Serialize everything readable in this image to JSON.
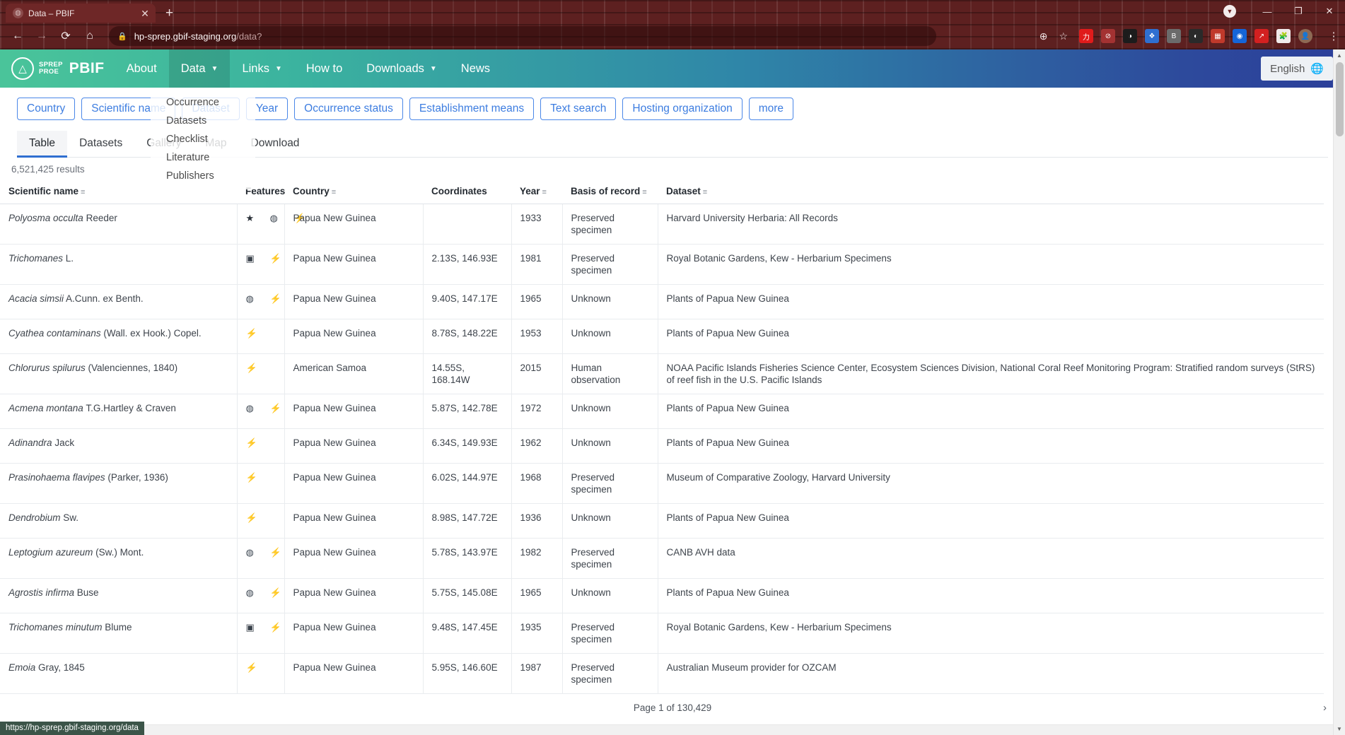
{
  "browser": {
    "tab": {
      "title": "Data – PBIF",
      "favicon_icon": "globe-icon",
      "close_icon": "✕"
    },
    "newtab_icon": "+",
    "window_controls": {
      "download_icon": "▼",
      "minimize": "—",
      "maximize": "❐",
      "close": "✕"
    },
    "nav": {
      "back": "←",
      "forward": "→",
      "reload": "⟳",
      "home": "⌂"
    },
    "omnibox": {
      "lock_icon": "🔒",
      "url_host": "hp-sprep.gbif-staging.org",
      "url_path": "/data?",
      "zoom_icon": "⊕",
      "bookmark_icon": "☆"
    },
    "extensions": [
      {
        "name": "extension-red-circle",
        "glyph": "力",
        "color": "#e01b1b"
      },
      {
        "name": "extension-adblock",
        "glyph": "⊘",
        "color": "#a33232"
      },
      {
        "name": "extension-dark-reader",
        "glyph": "◑",
        "color": "#1c1c1c"
      },
      {
        "name": "extension-dropbox",
        "glyph": "❖",
        "color": "#2f6fd0"
      },
      {
        "name": "extension-bitwarden",
        "glyph": "B",
        "color": "#6b6b6b"
      },
      {
        "name": "extension-moon",
        "glyph": "◐",
        "color": "#2a2a2a"
      },
      {
        "name": "extension-colorpicker",
        "glyph": "▦",
        "color": "#c0392b"
      },
      {
        "name": "extension-blue-ring",
        "glyph": "◉",
        "color": "#1565d8"
      },
      {
        "name": "extension-arrow-red",
        "glyph": "↗",
        "color": "#d32020"
      },
      {
        "name": "extension-puzzle",
        "glyph": "🧩",
        "color": "#f0eaea"
      },
      {
        "name": "profile-avatar",
        "glyph": "👤",
        "color": "#8d6a55"
      }
    ],
    "menu_icon": "⋮",
    "statusbar_url": "https://hp-sprep.gbif-staging.org/data"
  },
  "site": {
    "logo": {
      "sprep": "SPREP",
      "proe": "PROE",
      "pbif": "PBIF",
      "mark_icon": "monument-icon"
    },
    "nav_items": [
      {
        "label": "About",
        "has_caret": false,
        "active": false
      },
      {
        "label": "Data",
        "has_caret": true,
        "active": true
      },
      {
        "label": "Links",
        "has_caret": true,
        "active": false
      },
      {
        "label": "How to",
        "has_caret": false,
        "active": false
      },
      {
        "label": "Downloads",
        "has_caret": true,
        "active": false
      },
      {
        "label": "News",
        "has_caret": false,
        "active": false
      }
    ],
    "caret_icon": "▼",
    "language": {
      "label": "English",
      "icon": "translate-icon"
    },
    "dropdown": {
      "open_for": "Data",
      "items": [
        "Occurrence",
        "Datasets",
        "Checklist",
        "Literature",
        "Publishers"
      ]
    }
  },
  "filters": {
    "chips": [
      "Country",
      "Scientific name",
      "Dataset",
      "Year",
      "Occurrence status",
      "Establishment means",
      "Text search",
      "Hosting organization",
      "more"
    ]
  },
  "view_tabs": {
    "items": [
      "Table",
      "Datasets",
      "Gallery",
      "Map",
      "Download"
    ],
    "active": "Table"
  },
  "results": {
    "count_text": "6,521,425 results"
  },
  "table": {
    "filter_icon": "≡",
    "columns": [
      {
        "key": "scientific_name",
        "label": "Scientific name",
        "filterable": true
      },
      {
        "key": "features",
        "label": "Features",
        "filterable": false
      },
      {
        "key": "country",
        "label": "Country",
        "filterable": true
      },
      {
        "key": "coordinates",
        "label": "Coordinates",
        "filterable": false
      },
      {
        "key": "year",
        "label": "Year",
        "filterable": true
      },
      {
        "key": "basis_of_record",
        "label": "Basis of record",
        "filterable": true
      },
      {
        "key": "dataset",
        "label": "Dataset",
        "filterable": true
      }
    ],
    "icons": {
      "star": "★",
      "globe": "◍",
      "image": "▣",
      "bolt": "⚡"
    },
    "rows": [
      {
        "name_italic": "Polyosma occulta",
        "name_rest": " Reeder",
        "features": [
          "star",
          "globe",
          "bolt"
        ],
        "country": "Papua New Guinea",
        "coordinates": "",
        "year": "1933",
        "basis_of_record": "Preserved specimen",
        "dataset": "Harvard University Herbaria: All Records"
      },
      {
        "name_italic": "Trichomanes",
        "name_rest": " L.",
        "features": [
          "image",
          "bolt"
        ],
        "country": "Papua New Guinea",
        "coordinates": "2.13S, 146.93E",
        "year": "1981",
        "basis_of_record": "Preserved specimen",
        "dataset": "Royal Botanic Gardens, Kew - Herbarium Specimens"
      },
      {
        "name_italic": "Acacia simsii",
        "name_rest": " A.Cunn. ex Benth.",
        "features": [
          "globe",
          "bolt"
        ],
        "country": "Papua New Guinea",
        "coordinates": "9.40S, 147.17E",
        "year": "1965",
        "basis_of_record": "Unknown",
        "dataset": "Plants of Papua New Guinea"
      },
      {
        "name_italic": "Cyathea contaminans",
        "name_rest": " (Wall. ex Hook.) Copel.",
        "features": [
          "bolt"
        ],
        "country": "Papua New Guinea",
        "coordinates": "8.78S, 148.22E",
        "year": "1953",
        "basis_of_record": "Unknown",
        "dataset": "Plants of Papua New Guinea"
      },
      {
        "name_italic": "Chlorurus spilurus",
        "name_rest": " (Valenciennes, 1840)",
        "features": [
          "bolt"
        ],
        "country": "American Samoa",
        "coordinates": "14.55S, 168.14W",
        "year": "2015",
        "basis_of_record": "Human observation",
        "dataset": "NOAA Pacific Islands Fisheries Science Center, Ecosystem Sciences Division, National Coral Reef Monitoring Program: Stratified random surveys (StRS) of reef fish in the U.S. Pacific Islands"
      },
      {
        "name_italic": "Acmena montana",
        "name_rest": " T.G.Hartley & Craven",
        "features": [
          "globe",
          "bolt"
        ],
        "country": "Papua New Guinea",
        "coordinates": "5.87S, 142.78E",
        "year": "1972",
        "basis_of_record": "Unknown",
        "dataset": "Plants of Papua New Guinea"
      },
      {
        "name_italic": "Adinandra",
        "name_rest": " Jack",
        "features": [
          "bolt"
        ],
        "country": "Papua New Guinea",
        "coordinates": "6.34S, 149.93E",
        "year": "1962",
        "basis_of_record": "Unknown",
        "dataset": "Plants of Papua New Guinea"
      },
      {
        "name_italic": "Prasinohaema flavipes",
        "name_rest": " (Parker, 1936)",
        "features": [
          "bolt"
        ],
        "country": "Papua New Guinea",
        "coordinates": "6.02S, 144.97E",
        "year": "1968",
        "basis_of_record": "Preserved specimen",
        "dataset": "Museum of Comparative Zoology, Harvard University"
      },
      {
        "name_italic": "Dendrobium",
        "name_rest": " Sw.",
        "features": [
          "bolt"
        ],
        "country": "Papua New Guinea",
        "coordinates": "8.98S, 147.72E",
        "year": "1936",
        "basis_of_record": "Unknown",
        "dataset": "Plants of Papua New Guinea"
      },
      {
        "name_italic": "Leptogium azureum",
        "name_rest": " (Sw.) Mont.",
        "features": [
          "globe",
          "bolt"
        ],
        "country": "Papua New Guinea",
        "coordinates": "5.78S, 143.97E",
        "year": "1982",
        "basis_of_record": "Preserved specimen",
        "dataset": "CANB AVH data"
      },
      {
        "name_italic": "Agrostis infirma",
        "name_rest": " Buse",
        "features": [
          "globe",
          "bolt"
        ],
        "country": "Papua New Guinea",
        "coordinates": "5.75S, 145.08E",
        "year": "1965",
        "basis_of_record": "Unknown",
        "dataset": "Plants of Papua New Guinea"
      },
      {
        "name_italic": "Trichomanes minutum",
        "name_rest": " Blume",
        "features": [
          "image",
          "bolt"
        ],
        "country": "Papua New Guinea",
        "coordinates": "9.48S, 147.45E",
        "year": "1935",
        "basis_of_record": "Preserved specimen",
        "dataset": "Royal Botanic Gardens, Kew - Herbarium Specimens"
      },
      {
        "name_italic": "Emoia",
        "name_rest": " Gray, 1845",
        "features": [
          "bolt"
        ],
        "country": "Papua New Guinea",
        "coordinates": "5.95S, 146.60E",
        "year": "1987",
        "basis_of_record": "Preserved specimen",
        "dataset": "Australian Museum provider for OZCAM"
      }
    ]
  },
  "pagination": {
    "text": "Page 1 of 130,429",
    "next_icon": "›"
  },
  "colors": {
    "chrome_bg": "#5d2020",
    "nav_gradient_start": "#4ac49a",
    "nav_gradient_end": "#2c3f9a",
    "chip_blue": "#3d7de0",
    "active_tab_underline": "#2f6fd0",
    "bolt_orange": "#f5a524",
    "status_bg": "#3b5448"
  }
}
